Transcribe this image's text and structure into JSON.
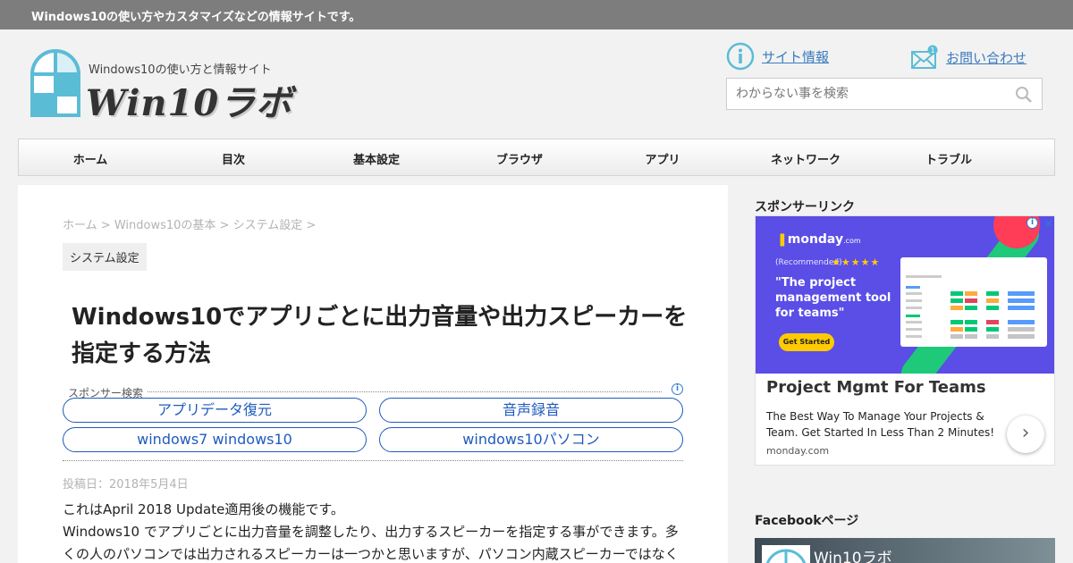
{
  "topbar": {
    "tagline": "Windows10の使い方やカスタマイズなどの情報サイトです。"
  },
  "logo": {
    "subtitle": "Windows10の使い方と情報サイト",
    "name": "Win10ラボ"
  },
  "header_links": {
    "site_info": "サイト情報",
    "contact": "お問い合わせ",
    "contact_badge": "1"
  },
  "search": {
    "placeholder": "わからない事を検索"
  },
  "nav": [
    "ホーム",
    "目次",
    "基本設定",
    "ブラウザ",
    "アプリ",
    "ネットワーク",
    "トラブル"
  ],
  "breadcrumb": {
    "home": "ホーム",
    "sep": ">",
    "level1": "Windows10の基本",
    "level2": "システム設定"
  },
  "category": "システム設定",
  "article": {
    "title": "Windows10でアプリごとに出力音量や出力スピーカーを指定する方法",
    "posted": "投稿日：2018年5月4日",
    "line1": "これはApril 2018 Update適用後の機能です。",
    "line2": "Windows10 でアプリごとに出力音量を調整したり、出力するスピーカーを指定する事ができます。多くの人のパソコンでは出力されるスピーカーは一つかと思いますが、パソコン内蔵スピーカーではなく"
  },
  "sponsor_search": {
    "label": "スポンサー検索",
    "links": [
      "アプリデータ復元",
      "音声録音",
      "windows7 windows10",
      "windows10パソコン"
    ]
  },
  "sidebar": {
    "sponsor_heading": "スポンサーリンク",
    "facebook_heading": "Facebookページ",
    "facebook_name": "Win10ラボ"
  },
  "ad": {
    "brand": "monday",
    "brand_suffix": ".com",
    "recommended": "(Recommended)",
    "stars": "★★★★★",
    "quote": "\"The project management tool for teams\"",
    "cta": "Get Started",
    "title": "Project Mgmt For Teams",
    "description": "The Best Way To Manage Your Projects & Team. Get Started In Less Than 2 Minutes!",
    "domain": "monday.com"
  },
  "colors": {
    "link": "#3b7bbf",
    "pill": "#1f5bbd",
    "topbar": "#7d7d7d",
    "logo_blue": "#5bbcd6",
    "ad_bg": "#5a4ee6"
  }
}
